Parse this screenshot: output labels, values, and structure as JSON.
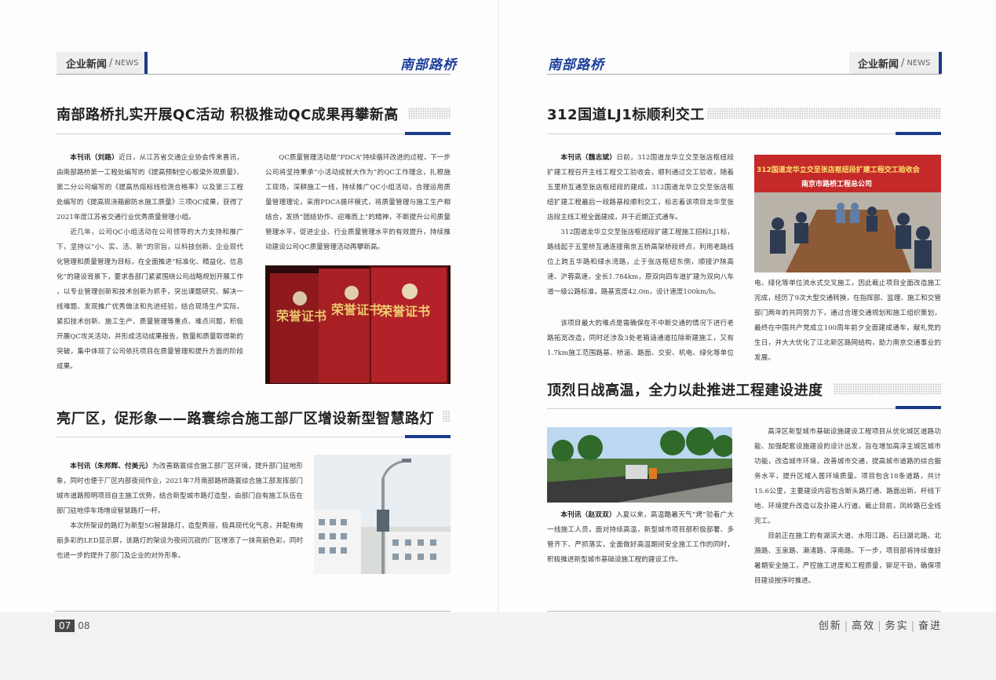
{
  "header": {
    "left_tab": "企业新闻",
    "left_tab_en": "NEWS",
    "logo": "南部路桥",
    "right_tab": "企业新闻",
    "right_tab_en": "NEWS"
  },
  "article1": {
    "title": "南部路桥扎实开展QC活动 积极推动QC成果再攀新高",
    "lead": "本刊讯（刘路）",
    "col1_p1": "近日，从江苏省交通企业协会传来喜讯，由南部路桥第一工程处编写的《提高预制空心板梁外观质量》、第二分公司编写的《提高热熔标线检测合格率》以及第三工程处编写的《提高现浇箱廊防水施工质量》三项QC成果，获得了2021年度江苏省交通行业优秀质量管理小组。",
    "col1_p2": "近几年，公司QC小组活动在公司领导的大力支持和推广下，坚持以“小、实、活、新”的宗旨，以科技创新、企业现代化管理和质量管理为目标，在全面推进“标准化、精益化、信息化”的建设背景下，要求各部门紧紧围绕公司战略规划开展工作 ，以专业管理创新和技术创新为抓手，突出课题研究、解决一线难题、发现推广优秀做法和先进经验，结合现场生产实际，紧扣技术创新、施工生产、质量管理等重点、难点问题，积极开展QC攻关活动，并形成活动成果报告，数量和质量取得新的突破，集中体现了公司依托项目在质量管理和提升方面的阶段成果。",
    "col2_p1": "QC质量管理活动是“PDCA”持续循环改进的过程，下一步公司将坚持秉承“小活动成就大作为”的QC工作理念，扎根施工现场，深耕施工一线，持续推广QC小组活动，合理运用质量管理理论，采用PDCA循环模式，将质量管理与施工生产相结合，发扬“团结协作、迎难而上”的精神，不断提升公司质量管理水平，促进企业、行业质量管理水平的有效提升，持续推动建设公司QC质量管理活动再攀新高。",
    "photo_text": "荣誉证书"
  },
  "article2": {
    "title": "亮厂区，促形象——路寰综合施工部厂区增设新型智慧路灯",
    "lead": "本刊讯（朱邦辉、付美元）",
    "p1": "为改善路寰综合施工部厂区环境，提升部门驻地形象，同时也便于厂区内部夜间作业，2021年7月南部路桥路寰综合施工部发挥部门城市道路照明项目自主施工优势，结合新型城市路灯造型，由部门自有施工队伍在部门驻地停车场增设智慧路灯一杆。",
    "p2": "本次所架设的路灯为新型5G智慧路灯，造型秀丽，极具现代化气息，并配有绚丽多彩的LED显示屏，该路灯的架设为夜间沉寂的厂区增添了一抹亮丽色彩，同时也进一步的提升了部门及企业的对外形象。"
  },
  "article3": {
    "title": "312国道LJ1标顺利交工",
    "lead": "本刊讯（魏志斌）",
    "p1": "日前，312国道龙华立交至张店枢纽段扩建工程召开主线工程交工验收会，顺利通过交工验收，随着五里桥互通至张店枢纽段的建成，312国道龙华立交至张店枢纽扩建工程最后一段路基段顺利交工，标志着该项目龙华至张店段主线工程全面建成，并于近期正式通车。",
    "p2": "312国道龙华立交至张店枢纽段扩建工程施工招标LJ1标，路线起于五里桥互通连接南京五桥高架桥段终点，利用老路线位上跨五华路和绿水湾路，止于张店枢纽东侧，顺接沪陕高速、沪蓉高速，全长1.784km，原双向四车道扩建为双向八车道一级公路标准，路基宽度42.0m，设计速度100km/h。",
    "p3": "该项目最大的难点是需确保在不中断交通的情况下进行老路拓宽改造，同时还涉及3处老箱涵通道拉除新建施工，又有1.7km施工范围路基、桥涵、路面、交安、机电、绿化等单位流水式交叉施工，因此截止项目全面改造施工完成，经历了9次大型交通转换，在指挥部、监理、施工和交管部门两年的共同努力下，通过合理交通规划和施工组织策划，最终在中国共产党成立100周年前夕全面建成通车，献礼党的生日，并大大优化了江北新区路网结构，助力南京交通事业的发展。",
    "photo_banner": "312国道龙华立交至张店枢纽段扩建工程交工验收会",
    "photo_sign": "南京市路桥工程总公司"
  },
  "article4": {
    "title": "顶烈日战高温，全力以赴推进工程建设进度",
    "lead": "本刊讯（赵双双）",
    "p1": "入夏以来，高温酷暑天气“烤”验着广大一线施工人员，面对持续高温，新型城市项目部积极部署、多管齐下、严抓落实，全面做好高温期间安全施工工作的同时，积极推进新型城市基础设施工程的建设工作。",
    "p2": "高淳区新型城市基础设施建设工程项目从优化城区道路功能、加强配套设施建设的设计出发，旨在增加高淳主城区城市功能，改造城市环境，改善城市交通，提高城市道路的综合服务水平，提升区域人居环境质量。项目包含18条道路，共计15.6公里，主要建设内容包含断头路打通、路面出新、杆线下地、环境提升改造以及扑建人行道。截止目前，凤岭路已全线完工。",
    "p3": "目前正在施工的有湖滨大道、水阳江路、石臼湖北路、北漪路、玉泉路、濑渚路、淳南路。下一步，项目部将持续做好暑期安全施工，严控施工进度和工程质量，铆足干劲，确保项目建设按序时推进。"
  },
  "footer": {
    "page_left": "07",
    "page_right": "08",
    "slogan_1": "创新",
    "slogan_2": "高效",
    "slogan_3": "务实",
    "slogan_4": "奋进"
  }
}
